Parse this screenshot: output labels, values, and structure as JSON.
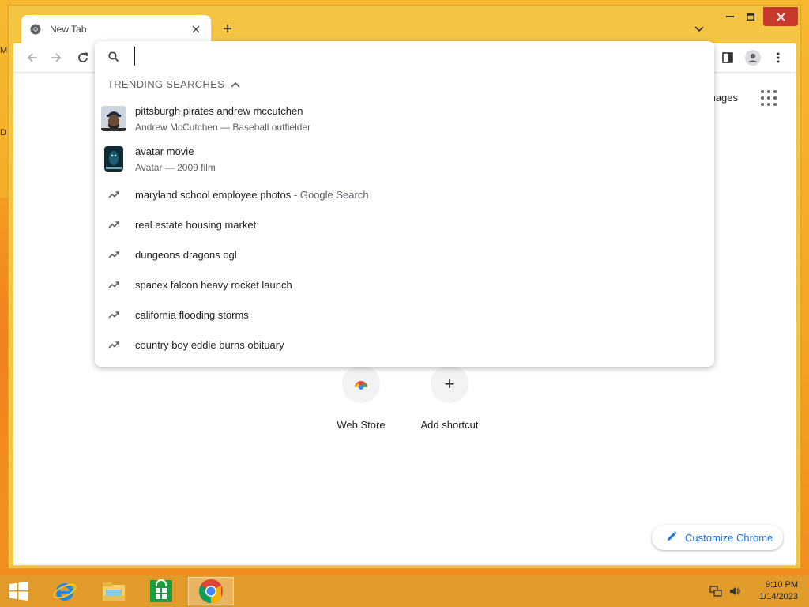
{
  "desktop": {
    "edge_letter_1": "M",
    "edge_letter_2": "D"
  },
  "browser": {
    "tab": {
      "title": "New Tab"
    },
    "new_tab_symbol": "+"
  },
  "omnibox": {
    "input_value": "",
    "section_title": "TRENDING SEARCHES",
    "suggestions": [
      {
        "kind": "entity",
        "text": "pittsburgh pirates andrew mccutchen",
        "subtitle": "Andrew McCutchen — Baseball outfielder"
      },
      {
        "kind": "entity",
        "text": "avatar movie",
        "subtitle": "Avatar — 2009 film"
      },
      {
        "kind": "trend",
        "text": "maryland school employee photos",
        "suffix": "- Google Search"
      },
      {
        "kind": "trend",
        "text": "real estate housing market"
      },
      {
        "kind": "trend",
        "text": "dungeons dragons ogl"
      },
      {
        "kind": "trend",
        "text": "spacex falcon heavy rocket launch"
      },
      {
        "kind": "trend",
        "text": "california flooding storms"
      },
      {
        "kind": "trend",
        "text": "country boy eddie burns obituary"
      }
    ]
  },
  "ntp": {
    "images_link": "mages",
    "shortcuts": [
      {
        "label": "Web Store"
      },
      {
        "label": "Add shortcut",
        "symbol": "+"
      }
    ],
    "customize_label": "Customize Chrome"
  },
  "taskbar": {
    "clock_time": "9:10 PM",
    "clock_date": "1/14/2023"
  },
  "colors": {
    "accent": "#1a73e8",
    "close": "#c7382d",
    "frame": "#f6c443"
  }
}
